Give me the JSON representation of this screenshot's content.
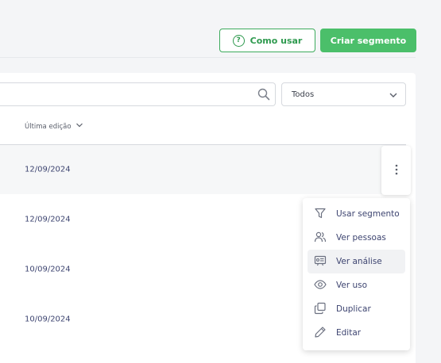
{
  "header": {
    "help_label": "Como usar",
    "create_label": "Criar segmento"
  },
  "filters": {
    "search_value": "",
    "select_value": "Todos"
  },
  "table": {
    "column_header": "Última edição",
    "rows": [
      {
        "date": "12/09/2024"
      },
      {
        "date": "12/09/2024"
      },
      {
        "date": "10/09/2024"
      },
      {
        "date": "10/09/2024"
      }
    ]
  },
  "menu": {
    "items": [
      {
        "label": "Usar segmento",
        "icon": "filter-icon"
      },
      {
        "label": "Ver pessoas",
        "icon": "people-icon"
      },
      {
        "label": "Ver análise",
        "icon": "analysis-icon"
      },
      {
        "label": "Ver uso",
        "icon": "eye-icon"
      },
      {
        "label": "Duplicar",
        "icon": "duplicate-icon"
      },
      {
        "label": "Editar",
        "icon": "pencil-icon"
      }
    ]
  },
  "colors": {
    "accent": "#4bbf6a",
    "accent_dark": "#2f9a4f",
    "text_dark": "#3d4470"
  }
}
